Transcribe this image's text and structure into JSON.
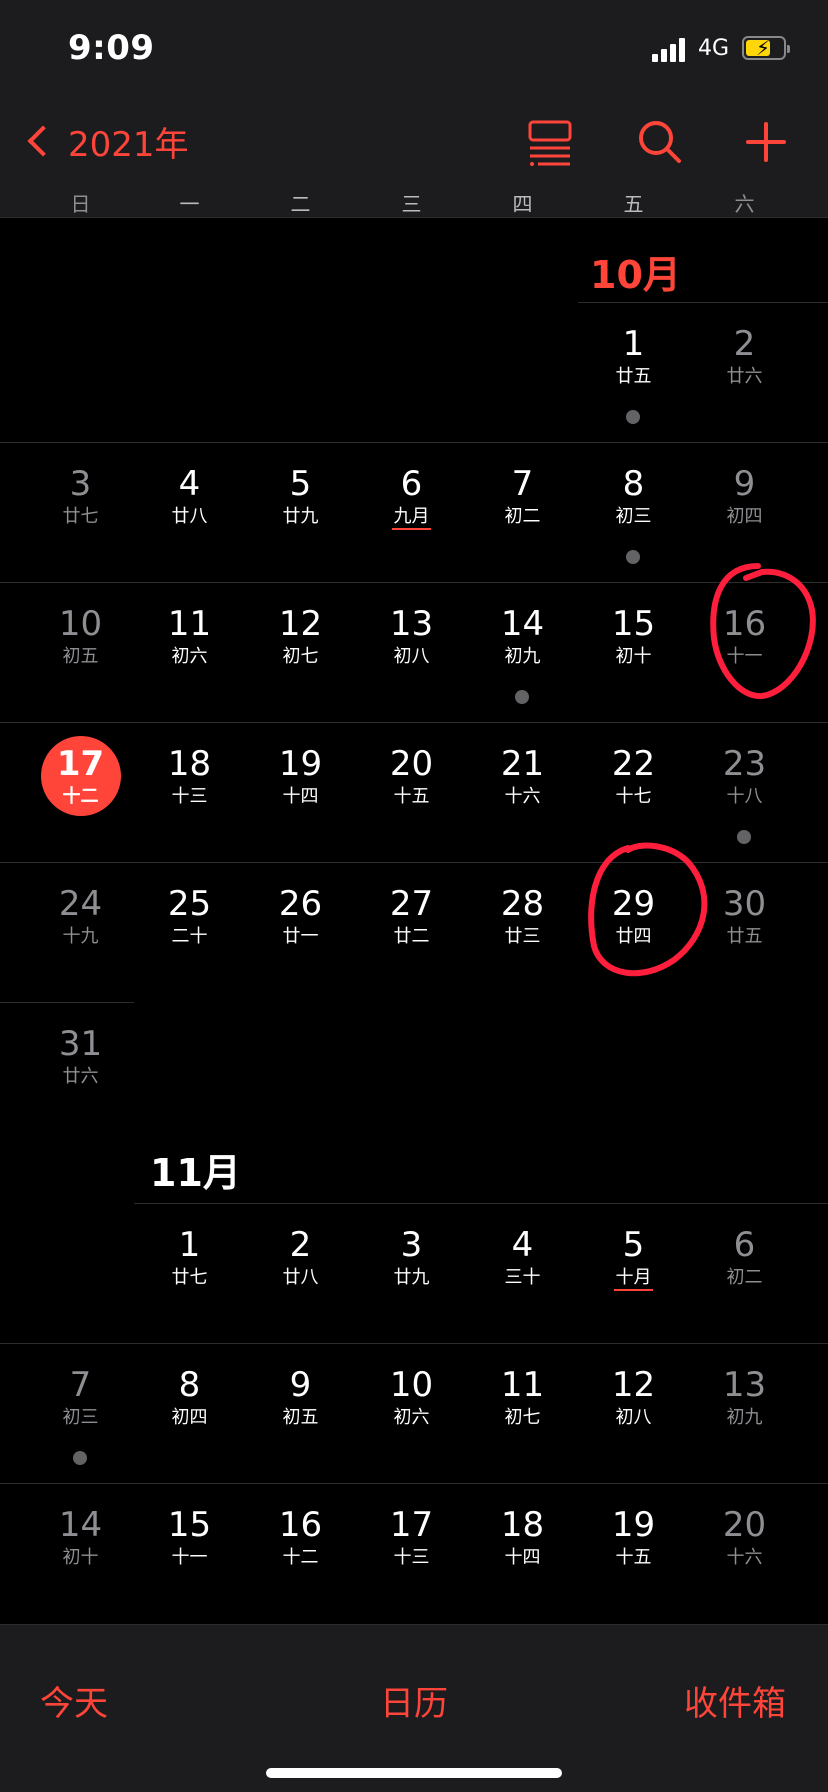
{
  "status": {
    "time": "9:09",
    "network": "4G"
  },
  "nav": {
    "year_label": "2021年"
  },
  "weekdays": [
    "日",
    "一",
    "二",
    "三",
    "四",
    "五",
    "六"
  ],
  "months": {
    "october": {
      "title": "10月"
    },
    "november": {
      "title": "11月"
    }
  },
  "days": [
    {
      "d": "1",
      "l": "廿五"
    },
    {
      "d": "2",
      "l": "廿六"
    },
    {
      "d": "3",
      "l": "廿七"
    },
    {
      "d": "4",
      "l": "廿八"
    },
    {
      "d": "5",
      "l": "廿九"
    },
    {
      "d": "6",
      "l": "九月"
    },
    {
      "d": "7",
      "l": "初二"
    },
    {
      "d": "8",
      "l": "初三"
    },
    {
      "d": "9",
      "l": "初四"
    },
    {
      "d": "10",
      "l": "初五"
    },
    {
      "d": "11",
      "l": "初六"
    },
    {
      "d": "12",
      "l": "初七"
    },
    {
      "d": "13",
      "l": "初八"
    },
    {
      "d": "14",
      "l": "初九"
    },
    {
      "d": "15",
      "l": "初十"
    },
    {
      "d": "16",
      "l": "十一"
    },
    {
      "d": "17",
      "l": "十二"
    },
    {
      "d": "18",
      "l": "十三"
    },
    {
      "d": "19",
      "l": "十四"
    },
    {
      "d": "20",
      "l": "十五"
    },
    {
      "d": "21",
      "l": "十六"
    },
    {
      "d": "22",
      "l": "十七"
    },
    {
      "d": "23",
      "l": "十八"
    },
    {
      "d": "24",
      "l": "十九"
    },
    {
      "d": "25",
      "l": "二十"
    },
    {
      "d": "26",
      "l": "廿一"
    },
    {
      "d": "27",
      "l": "廿二"
    },
    {
      "d": "28",
      "l": "廿三"
    },
    {
      "d": "29",
      "l": "廿四"
    },
    {
      "d": "30",
      "l": "廿五"
    },
    {
      "d": "31",
      "l": "廿六"
    },
    {
      "d": "1",
      "l": "廿七"
    },
    {
      "d": "2",
      "l": "廿八"
    },
    {
      "d": "3",
      "l": "廿九"
    },
    {
      "d": "4",
      "l": "三十"
    },
    {
      "d": "5",
      "l": "十月"
    },
    {
      "d": "6",
      "l": "初二"
    },
    {
      "d": "7",
      "l": "初三"
    },
    {
      "d": "8",
      "l": "初四"
    },
    {
      "d": "9",
      "l": "初五"
    },
    {
      "d": "10",
      "l": "初六"
    },
    {
      "d": "11",
      "l": "初七"
    },
    {
      "d": "12",
      "l": "初八"
    },
    {
      "d": "13",
      "l": "初九"
    },
    {
      "d": "14",
      "l": "初十"
    },
    {
      "d": "15",
      "l": "十一"
    },
    {
      "d": "16",
      "l": "十二"
    },
    {
      "d": "17",
      "l": "十三"
    },
    {
      "d": "18",
      "l": "十四"
    },
    {
      "d": "19",
      "l": "十五"
    },
    {
      "d": "20",
      "l": "十六"
    }
  ],
  "toolbar": {
    "today": "今天",
    "calendars": "日历",
    "inbox": "收件箱"
  },
  "colors": {
    "accent": "#ff453a",
    "annotation": "#ff1f3d",
    "dot": "#636366"
  }
}
